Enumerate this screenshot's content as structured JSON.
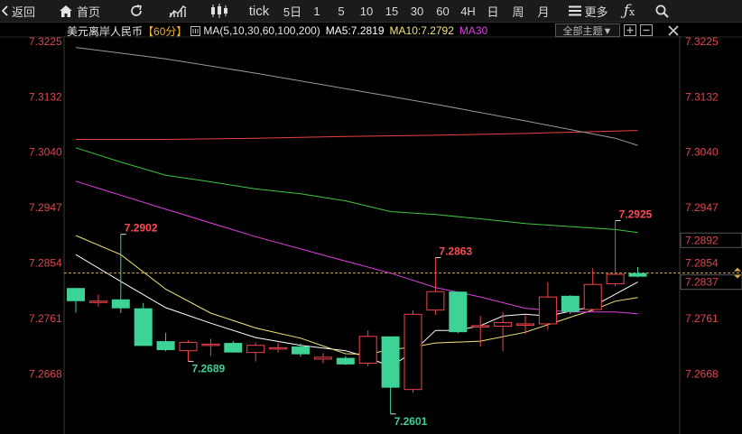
{
  "toolbar": {
    "back_label": "返回",
    "home_label": "首页",
    "tick_label": "tick",
    "periods": [
      "5日",
      "1",
      "5",
      "10",
      "15",
      "30",
      "60",
      "4H",
      "日",
      "周",
      "月"
    ],
    "more_label": "更多"
  },
  "legend": {
    "symbol": "美元离岸人民币",
    "period": "【60分】",
    "ma_params": "MA(5,10,30,60,100,200)",
    "ma5": "MA5:7.2819",
    "ma10": "MA10:7.2792",
    "ma30": "MA30",
    "theme_button": "全部主题▼"
  },
  "colors": {
    "up": "#f0454d",
    "down": "#3dd296",
    "ma5": "#ffffff",
    "ma10": "#f3e67a",
    "ma30": "#e03fe0",
    "ma60": "#3ec63e",
    "ma100": "#e74242",
    "ma200": "#9a9a9a",
    "axis_text": "#e0464e",
    "current_price_line": "#d4a84a"
  },
  "chart_data": {
    "type": "candlestick",
    "y_ticks": [
      "7.3225",
      "7.3132",
      "7.3040",
      "7.2947",
      "7.2854",
      "7.2761",
      "7.2668"
    ],
    "ylim": [
      7.2575,
      7.3225
    ],
    "current_price": "7.2837",
    "right_price_box": "7.2892",
    "candles": [
      {
        "o": 7.2812,
        "h": 7.2812,
        "l": 7.2771,
        "c": 7.279
      },
      {
        "o": 7.279,
        "h": 7.2801,
        "l": 7.2781,
        "c": 7.279
      },
      {
        "o": 7.2793,
        "h": 7.2902,
        "l": 7.277,
        "c": 7.2778
      },
      {
        "o": 7.2778,
        "h": 7.2787,
        "l": 7.2716,
        "c": 7.2715
      },
      {
        "o": 7.2723,
        "h": 7.2737,
        "l": 7.2706,
        "c": 7.2708
      },
      {
        "o": 7.2707,
        "h": 7.2724,
        "l": 7.2689,
        "c": 7.2721
      },
      {
        "o": 7.2717,
        "h": 7.2727,
        "l": 7.2698,
        "c": 7.2718
      },
      {
        "o": 7.272,
        "h": 7.2723,
        "l": 7.2704,
        "c": 7.2704
      },
      {
        "o": 7.2704,
        "h": 7.2721,
        "l": 7.2689,
        "c": 7.2716
      },
      {
        "o": 7.2711,
        "h": 7.272,
        "l": 7.2704,
        "c": 7.2712
      },
      {
        "o": 7.2714,
        "h": 7.2719,
        "l": 7.2697,
        "c": 7.2701
      },
      {
        "o": 7.2693,
        "h": 7.2703,
        "l": 7.2686,
        "c": 7.2696
      },
      {
        "o": 7.2695,
        "h": 7.2698,
        "l": 7.2683,
        "c": 7.2684
      },
      {
        "o": 7.2686,
        "h": 7.2741,
        "l": 7.2681,
        "c": 7.2731
      },
      {
        "o": 7.2731,
        "h": 7.2731,
        "l": 7.2601,
        "c": 7.2645
      },
      {
        "o": 7.2642,
        "h": 7.2774,
        "l": 7.2637,
        "c": 7.2768
      },
      {
        "o": 7.2775,
        "h": 7.2863,
        "l": 7.2767,
        "c": 7.2806
      },
      {
        "o": 7.2806,
        "h": 7.2806,
        "l": 7.2736,
        "c": 7.2738
      },
      {
        "o": 7.2749,
        "h": 7.2765,
        "l": 7.2714,
        "c": 7.2749
      },
      {
        "o": 7.2748,
        "h": 7.2772,
        "l": 7.2706,
        "c": 7.2754
      },
      {
        "o": 7.2752,
        "h": 7.2766,
        "l": 7.2735,
        "c": 7.2752
      },
      {
        "o": 7.2752,
        "h": 7.2822,
        "l": 7.2742,
        "c": 7.2797
      },
      {
        "o": 7.2799,
        "h": 7.28,
        "l": 7.2768,
        "c": 7.2772
      },
      {
        "o": 7.2776,
        "h": 7.2845,
        "l": 7.2773,
        "c": 7.2818
      },
      {
        "o": 7.2819,
        "h": 7.2925,
        "l": 7.2815,
        "c": 7.2835
      },
      {
        "o": 7.2837,
        "h": 7.2847,
        "l": 7.283,
        "c": 7.2831
      }
    ],
    "annotations": [
      {
        "label": "7.2902",
        "candle": 2,
        "value": 7.2902,
        "pos": "high"
      },
      {
        "label": "7.2689",
        "candle": 5,
        "value": 7.2689,
        "pos": "low"
      },
      {
        "label": "7.2863",
        "candle": 16,
        "value": 7.2863,
        "pos": "high"
      },
      {
        "label": "7.2601",
        "candle": 14,
        "value": 7.2601,
        "pos": "low"
      },
      {
        "label": "7.2925",
        "candle": 24,
        "value": 7.2925,
        "pos": "high"
      }
    ],
    "ma_lines": {
      "ma5": [
        [
          0,
          7.2868
        ],
        [
          2,
          7.2823
        ],
        [
          4,
          7.2779
        ],
        [
          6,
          7.2753
        ],
        [
          8,
          7.2729
        ],
        [
          10,
          7.2716
        ],
        [
          12,
          7.2707
        ],
        [
          13,
          7.2696
        ],
        [
          14,
          7.268
        ],
        [
          15,
          7.2705
        ],
        [
          16,
          7.2741
        ],
        [
          17,
          7.2741
        ],
        [
          18,
          7.2749
        ],
        [
          19,
          7.2765
        ],
        [
          20,
          7.2768
        ],
        [
          21,
          7.2765
        ],
        [
          23,
          7.2781
        ],
        [
          25,
          7.2822
        ]
      ],
      "ma10": [
        [
          0,
          7.29
        ],
        [
          2,
          7.2868
        ],
        [
          4,
          7.281
        ],
        [
          6,
          7.277
        ],
        [
          8,
          7.2745
        ],
        [
          10,
          7.2728
        ],
        [
          12,
          7.2702
        ],
        [
          13,
          7.2701
        ],
        [
          14,
          7.2709
        ],
        [
          15,
          7.2713
        ],
        [
          16,
          7.272
        ],
        [
          18,
          7.2723
        ],
        [
          20,
          7.2738
        ],
        [
          22,
          7.2763
        ],
        [
          23,
          7.2775
        ],
        [
          24,
          7.279
        ],
        [
          25,
          7.2796
        ]
      ],
      "ma30": [
        [
          0,
          7.2991
        ],
        [
          4,
          7.2944
        ],
        [
          8,
          7.2898
        ],
        [
          12,
          7.2857
        ],
        [
          14,
          7.2837
        ],
        [
          16,
          7.2813
        ],
        [
          18,
          7.2797
        ],
        [
          20,
          7.2778
        ],
        [
          22,
          7.2772
        ],
        [
          24,
          7.2772
        ],
        [
          25,
          7.2769
        ]
      ],
      "ma60": [
        [
          0,
          7.3047
        ],
        [
          2,
          7.3023
        ],
        [
          4,
          7.3001
        ],
        [
          6,
          7.299
        ],
        [
          8,
          7.2978
        ],
        [
          10,
          7.297
        ],
        [
          12,
          7.2958
        ],
        [
          14,
          7.294
        ],
        [
          16,
          7.2935
        ],
        [
          18,
          7.2928
        ],
        [
          20,
          7.292
        ],
        [
          22,
          7.2915
        ],
        [
          24,
          7.291
        ],
        [
          25,
          7.2905
        ]
      ],
      "ma100": [
        [
          0,
          7.3061
        ],
        [
          4,
          7.3061
        ],
        [
          8,
          7.3063
        ],
        [
          12,
          7.3066
        ],
        [
          16,
          7.3068
        ],
        [
          20,
          7.3071
        ],
        [
          24,
          7.3075
        ],
        [
          25,
          7.3076
        ]
      ],
      "ma200": [
        [
          0,
          7.3215
        ],
        [
          4,
          7.3196
        ],
        [
          8,
          7.3172
        ],
        [
          12,
          7.3146
        ],
        [
          16,
          7.312
        ],
        [
          20,
          7.3092
        ],
        [
          24,
          7.3063
        ],
        [
          25,
          7.3051
        ]
      ]
    }
  }
}
